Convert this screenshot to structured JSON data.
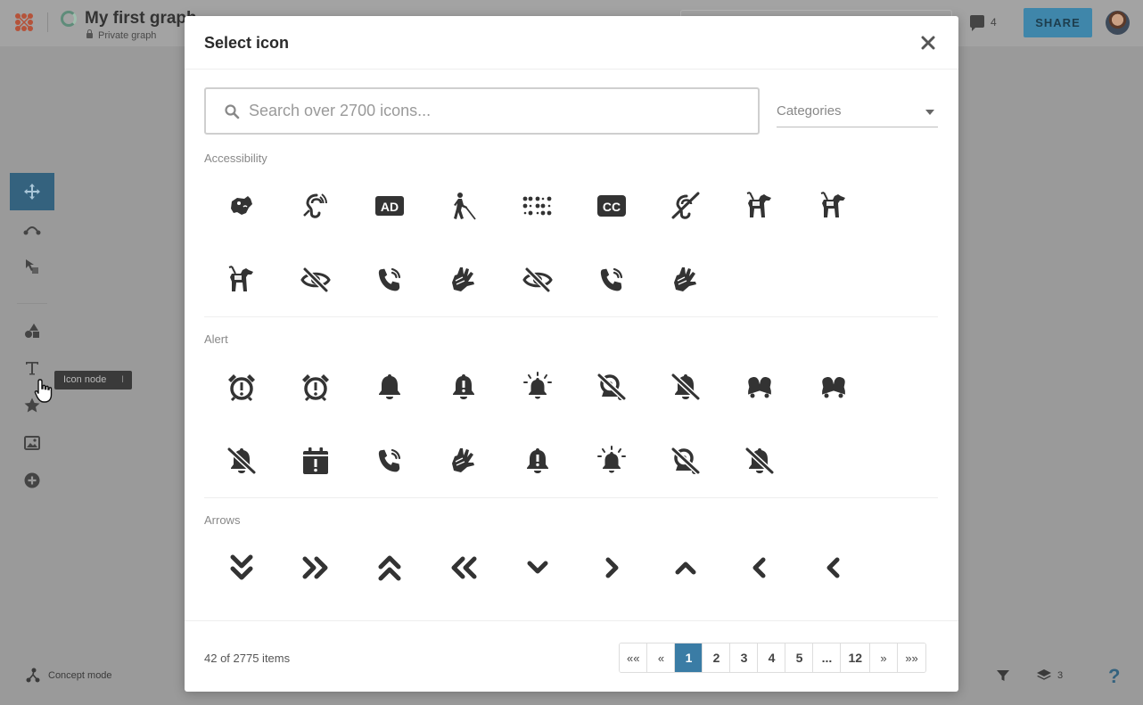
{
  "app": {
    "graph_title": "My first graph",
    "graph_visibility": "Private graph",
    "comment_count": "4",
    "share_label": "SHARE",
    "tooltip_label": "Icon node",
    "tooltip_key": "I",
    "concept_mode_label": "Concept mode",
    "layers_count": "3",
    "help_label": "?"
  },
  "modal": {
    "title": "Select icon",
    "search_placeholder": "Search over 2700 icons...",
    "categories_label": "Categories",
    "sections": [
      {
        "title": "Accessibility",
        "icons": [
          "assistive-listening-dog-icon",
          "assistive-listening-ear-icon",
          "audio-description-icon",
          "blind-walking-icon",
          "braille-icon",
          "closed-captioning-icon",
          "deaf-icon",
          "guide-dog-icon",
          "guide-dog-icon",
          "guide-dog-icon",
          "eye-slash-icon",
          "phone-volume-icon",
          "sign-language-icon",
          "eye-slash-icon",
          "phone-volume-icon",
          "sign-language-icon"
        ]
      },
      {
        "title": "Alert",
        "icons": [
          "alarm-clock-exclamation-icon",
          "alarm-clock-exclamation-icon",
          "bell-icon",
          "bell-exclamation-icon",
          "bell-on-icon",
          "bell-school-slash-icon",
          "bell-slash-icon",
          "bells-icon",
          "bells-icon",
          "bell-slash-icon",
          "calendar-exclamation-icon",
          "phone-volume-icon",
          "sign-language-icon",
          "bell-exclamation-icon",
          "bell-on-icon",
          "bell-school-slash-icon",
          "bell-slash-icon"
        ]
      },
      {
        "title": "Arrows",
        "icons": [
          "chevron-double-down-icon",
          "chevron-double-right-icon",
          "chevron-double-up-icon",
          "chevron-double-left-icon",
          "chevron-down-icon",
          "chevron-right-icon",
          "chevron-up-icon",
          "chevron-left-icon",
          "chevron-left-icon"
        ]
      }
    ],
    "items_count": "42 of 2775 items",
    "pagination": [
      "««",
      "«",
      "1",
      "2",
      "3",
      "4",
      "5",
      "...",
      "12",
      "»",
      "»»"
    ],
    "current_page": "1"
  }
}
